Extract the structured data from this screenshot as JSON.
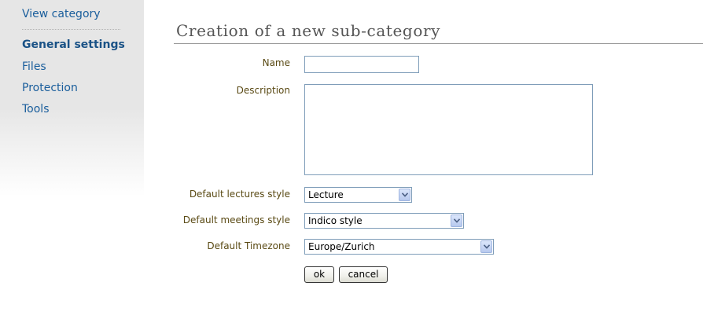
{
  "sidebar": {
    "view_category": "View category",
    "items": [
      {
        "label": "General settings",
        "active": true
      },
      {
        "label": "Files",
        "active": false
      },
      {
        "label": "Protection",
        "active": false
      },
      {
        "label": "Tools",
        "active": false
      }
    ]
  },
  "page": {
    "title": "Creation of a new sub-category"
  },
  "form": {
    "name_label": "Name",
    "name_value": "",
    "description_label": "Description",
    "description_value": "",
    "lectures_style_label": "Default lectures style",
    "lectures_style_value": "Lecture",
    "meetings_style_label": "Default meetings style",
    "meetings_style_value": "Indico style",
    "timezone_label": "Default Timezone",
    "timezone_value": "Europe/Zurich",
    "ok_label": "ok",
    "cancel_label": "cancel"
  },
  "colors": {
    "link": "#1a5e9c",
    "label": "#5a4a14",
    "title": "#555555"
  },
  "icons": {
    "select_arrow": "chevron-down-icon"
  }
}
